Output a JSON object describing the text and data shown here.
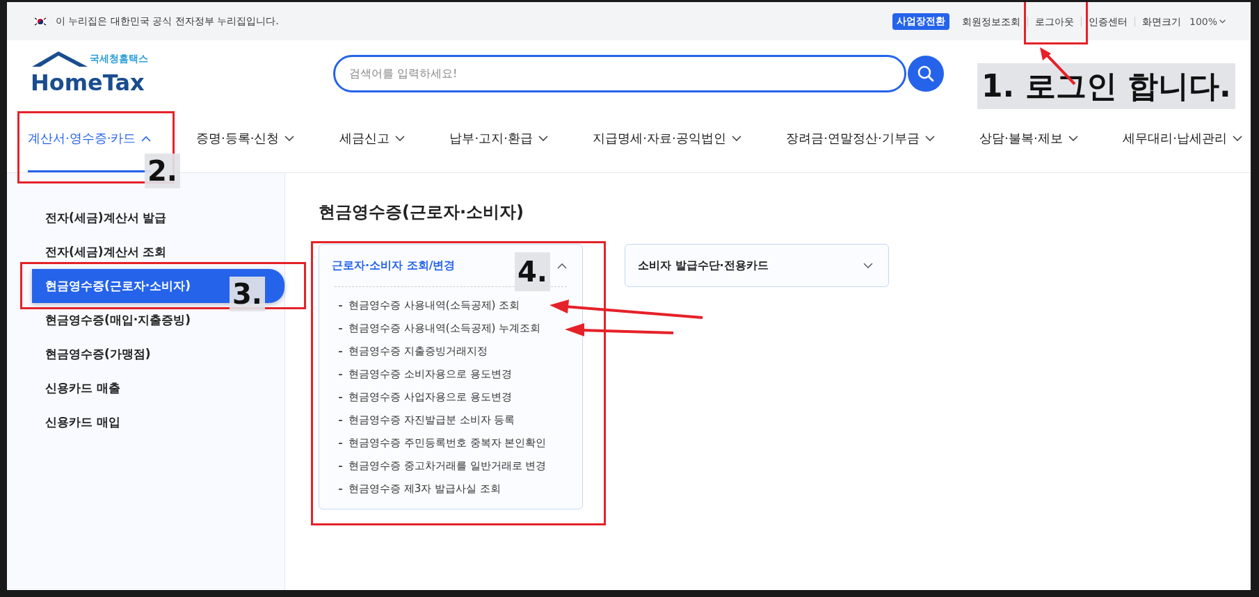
{
  "top_bar": {
    "notice": "이 누리집은 대한민국 공식 전자정부 누리집입니다.",
    "badge": "사업장전환",
    "links": [
      "회원정보조회",
      "로그아웃",
      "인증센터"
    ],
    "zoom_label": "화면크기",
    "zoom_value": "100%"
  },
  "header": {
    "logo_subtitle": "국세청홈택스",
    "logo_title": "HomeTax",
    "search": {
      "placeholder": "검색어를 입력하세요!"
    }
  },
  "nav": [
    {
      "label": "계산서·영수증·카드",
      "selected": true
    },
    {
      "label": "증명·등록·신청",
      "selected": false
    },
    {
      "label": "세금신고",
      "selected": false
    },
    {
      "label": "납부·고지·환급",
      "selected": false
    },
    {
      "label": "지급명세·자료·공익법인",
      "selected": false
    },
    {
      "label": "장려금·연말정산·기부금",
      "selected": false
    },
    {
      "label": "상담·불복·제보",
      "selected": false
    },
    {
      "label": "세무대리·납세관리",
      "selected": false
    }
  ],
  "sidebar": {
    "items": [
      {
        "label": "전자(세금)계산서 발급",
        "selected": false
      },
      {
        "label": "전자(세금)계산서 조회",
        "selected": false
      },
      {
        "label": "현금영수증(근로자·소비자)",
        "selected": true
      },
      {
        "label": "현금영수증(매입·지출증빙)",
        "selected": false
      },
      {
        "label": "현금영수증(가맹점)",
        "selected": false
      },
      {
        "label": "신용카드 매출",
        "selected": false
      },
      {
        "label": "신용카드 매입",
        "selected": false
      }
    ]
  },
  "content": {
    "title": "현금영수증(근로자·소비자)",
    "panels": [
      {
        "title": "근로자·소비자 조회/변경",
        "expanded": true,
        "items": [
          "현금영수증 사용내역(소득공제) 조회",
          "현금영수증 사용내역(소득공제) 누계조회",
          "현금영수증 지출증빙거래지정",
          "현금영수증 소비자용으로 용도변경",
          "현금영수증 사업자용으로 용도변경",
          "현금영수증 자진발급분 소비자 등록",
          "현금영수증 주민등록번호 중복자 본인확인",
          "현금영수증 중고차거래를 일반거래로 변경",
          "현금영수증 제3자 발급사실 조회"
        ]
      },
      {
        "title": "소비자 발급수단·전용카드",
        "expanded": false
      }
    ]
  },
  "annotations": [
    {
      "label": "1. 로그인 합니다."
    },
    {
      "label": "2."
    },
    {
      "label": "3."
    },
    {
      "label": "4."
    }
  ]
}
